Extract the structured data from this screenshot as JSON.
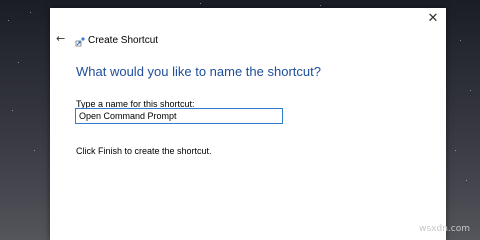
{
  "dialog": {
    "title": "Create Shortcut",
    "heading": "What would you like to name the shortcut?",
    "field_label": "Type a name for this shortcut:",
    "name_value": "Open Command Prompt",
    "finish_text": "Click Finish to create the shortcut.",
    "close_glyph": "✕",
    "back_glyph": "←"
  },
  "watermark": "wsxdn.com",
  "icons": [
    "close-icon",
    "back-arrow-icon",
    "shortcut-icon"
  ],
  "colors": {
    "heading": "#1f4e9a",
    "input_border": "#2f7dd1"
  }
}
